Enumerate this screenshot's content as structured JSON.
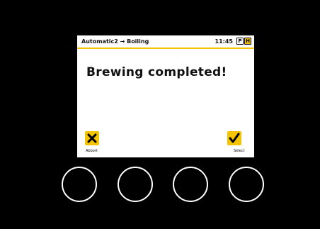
{
  "status_bar": {
    "breadcrumb": "Automatic2 → Boiling",
    "time": "11:45",
    "mode_p": "P",
    "mode_h": "H"
  },
  "main": {
    "message": "Brewing completed!"
  },
  "softkeys": {
    "abort": {
      "label": "Abbort",
      "icon": "close-icon"
    },
    "select": {
      "label": "Select",
      "icon": "check-icon"
    }
  },
  "colors": {
    "accent": "#f5c400",
    "screen_background": "#ffffff",
    "device_background": "#000000"
  }
}
